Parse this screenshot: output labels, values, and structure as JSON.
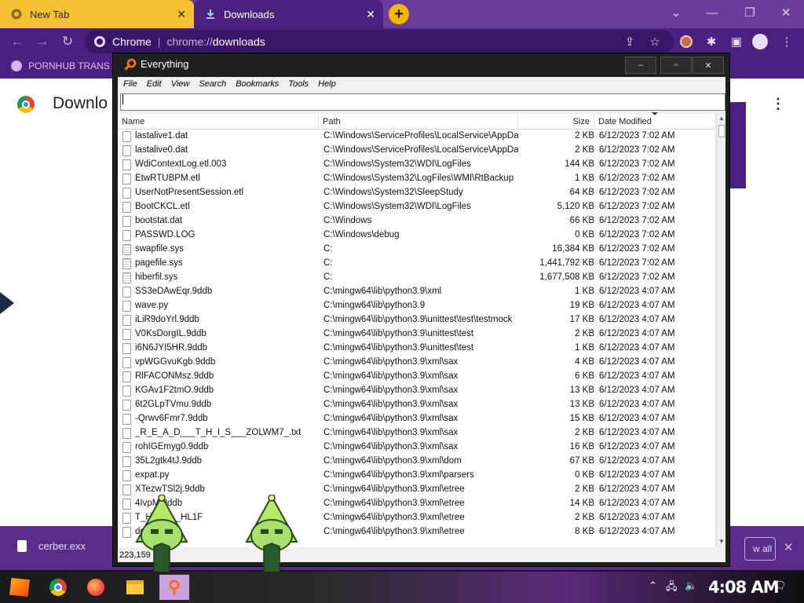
{
  "browser": {
    "tabs": [
      {
        "title": "New Tab"
      },
      {
        "title": "Downloads"
      }
    ],
    "omnibox": {
      "site": "Chrome",
      "url_prefix": "chrome://",
      "url_host": "downloads"
    },
    "bookmarks": [
      {
        "label": "PORNHUB TRANS"
      }
    ],
    "page_title": "Downlo",
    "shelf": {
      "file": "cerber.exx",
      "show_all": "w all"
    },
    "colors": {
      "tab_active": "#4b2080",
      "tab_inactive": "#f5c033",
      "frame": "#6a3d9a"
    }
  },
  "everything": {
    "title": "Everything",
    "menu": [
      "File",
      "Edit",
      "View",
      "Search",
      "Bookmarks",
      "Tools",
      "Help"
    ],
    "search_value": "",
    "columns": {
      "name": "Name",
      "path": "Path",
      "size": "Size",
      "date": "Date Modified"
    },
    "rows": [
      {
        "name": "lastalive1.dat",
        "path": "C:\\Windows\\ServiceProfiles\\LocalService\\AppDat...",
        "size": "2 KB",
        "date": "6/12/2023 7:02 AM"
      },
      {
        "name": "lastalive0.dat",
        "path": "C:\\Windows\\ServiceProfiles\\LocalService\\AppDat...",
        "size": "2 KB",
        "date": "6/12/2023 7:02 AM"
      },
      {
        "name": "WdiContextLog.etl.003",
        "path": "C:\\Windows\\System32\\WDI\\LogFiles",
        "size": "144 KB",
        "date": "6/12/2023 7:02 AM"
      },
      {
        "name": "EtwRTUBPM.etl",
        "path": "C:\\Windows\\System32\\LogFiles\\WMI\\RtBackup",
        "size": "1 KB",
        "date": "6/12/2023 7:02 AM"
      },
      {
        "name": "UserNotPresentSession.etl",
        "path": "C:\\Windows\\System32\\SleepStudy",
        "size": "64 KB",
        "date": "6/12/2023 7:02 AM"
      },
      {
        "name": "BootCKCL.etl",
        "path": "C:\\Windows\\System32\\WDI\\LogFiles",
        "size": "5,120 KB",
        "date": "6/12/2023 7:02 AM"
      },
      {
        "name": "bootstat.dat",
        "path": "C:\\Windows",
        "size": "66 KB",
        "date": "6/12/2023 7:02 AM"
      },
      {
        "name": "PASSWD.LOG",
        "path": "C:\\Windows\\debug",
        "size": "0 KB",
        "date": "6/12/2023 7:02 AM"
      },
      {
        "name": "swapfile.sys",
        "path": "C:",
        "size": "16,384 KB",
        "date": "6/12/2023 7:02 AM",
        "sys": true
      },
      {
        "name": "pagefile.sys",
        "path": "C:",
        "size": "1,441,792 KB",
        "date": "6/12/2023 7:02 AM",
        "sys": true
      },
      {
        "name": "hiberfil.sys",
        "path": "C:",
        "size": "1,677,508 KB",
        "date": "6/12/2023 7:02 AM",
        "sys": true
      },
      {
        "name": "SS3eDAwEqr.9ddb",
        "path": "C:\\mingw64\\lib\\python3.9\\xml",
        "size": "1 KB",
        "date": "6/12/2023 4:07 AM"
      },
      {
        "name": "wave.py",
        "path": "C:\\mingw64\\lib\\python3.9",
        "size": "19 KB",
        "date": "6/12/2023 4:07 AM"
      },
      {
        "name": "iLiR9doYrl.9ddb",
        "path": "C:\\mingw64\\lib\\python3.9\\unittest\\test\\testmock",
        "size": "17 KB",
        "date": "6/12/2023 4:07 AM"
      },
      {
        "name": "V0KsDorgIL.9ddb",
        "path": "C:\\mingw64\\lib\\python3.9\\unittest\\test",
        "size": "2 KB",
        "date": "6/12/2023 4:07 AM"
      },
      {
        "name": "i6N6JYI5HR.9ddb",
        "path": "C:\\mingw64\\lib\\python3.9\\unittest\\test",
        "size": "1 KB",
        "date": "6/12/2023 4:07 AM"
      },
      {
        "name": "vpWGGvuKgb.9ddb",
        "path": "C:\\mingw64\\lib\\python3.9\\xml\\sax",
        "size": "4 KB",
        "date": "6/12/2023 4:07 AM"
      },
      {
        "name": "RlFACONMsz.9ddb",
        "path": "C:\\mingw64\\lib\\python3.9\\xml\\sax",
        "size": "6 KB",
        "date": "6/12/2023 4:07 AM"
      },
      {
        "name": "KGAv1F2tmO.9ddb",
        "path": "C:\\mingw64\\lib\\python3.9\\xml\\sax",
        "size": "13 KB",
        "date": "6/12/2023 4:07 AM"
      },
      {
        "name": "6t2GLpTVmu.9ddb",
        "path": "C:\\mingw64\\lib\\python3.9\\xml\\sax",
        "size": "13 KB",
        "date": "6/12/2023 4:07 AM"
      },
      {
        "name": "-Qrwv6Fmr7.9ddb",
        "path": "C:\\mingw64\\lib\\python3.9\\xml\\sax",
        "size": "15 KB",
        "date": "6/12/2023 4:07 AM"
      },
      {
        "name": "_R_E_A_D___T_H_I_S___ZOLWM7_.txt",
        "path": "C:\\mingw64\\lib\\python3.9\\xml\\sax",
        "size": "2 KB",
        "date": "6/12/2023 4:07 AM"
      },
      {
        "name": "rohIGEmyg0.9ddb",
        "path": "C:\\mingw64\\lib\\python3.9\\xml\\sax",
        "size": "16 KB",
        "date": "6/12/2023 4:07 AM"
      },
      {
        "name": "35L2gtk4tJ.9ddb",
        "path": "C:\\mingw64\\lib\\python3.9\\xml\\dom",
        "size": "67 KB",
        "date": "6/12/2023 4:07 AM"
      },
      {
        "name": "expat.py",
        "path": "C:\\mingw64\\lib\\python3.9\\xml\\parsers",
        "size": "0 KB",
        "date": "6/12/2023 4:07 AM"
      },
      {
        "name": "XTezwTSl2j.9ddb",
        "path": "C:\\mingw64\\lib\\python3.9\\xml\\etree",
        "size": "2 KB",
        "date": "6/12/2023 4:07 AM"
      },
      {
        "name": "4IvpM.9ddb",
        "path": "C:\\mingw64\\lib\\python3.9\\xml\\etree",
        "size": "14 KB",
        "date": "6/12/2023 4:07 AM"
      },
      {
        "name": "T_H_I_S__HL1F",
        "path": "C:\\mingw64\\lib\\python3.9\\xml\\etree",
        "size": "2 KB",
        "date": "6/12/2023 4:07 AM"
      },
      {
        "name": "ddb",
        "path": "C:\\mingw64\\lib\\python3.9\\xml\\etree",
        "size": "8 KB",
        "date": "6/12/2023 4:07 AM"
      }
    ],
    "status": "223,159"
  },
  "taskbar": {
    "clock": "4:08 AM"
  }
}
